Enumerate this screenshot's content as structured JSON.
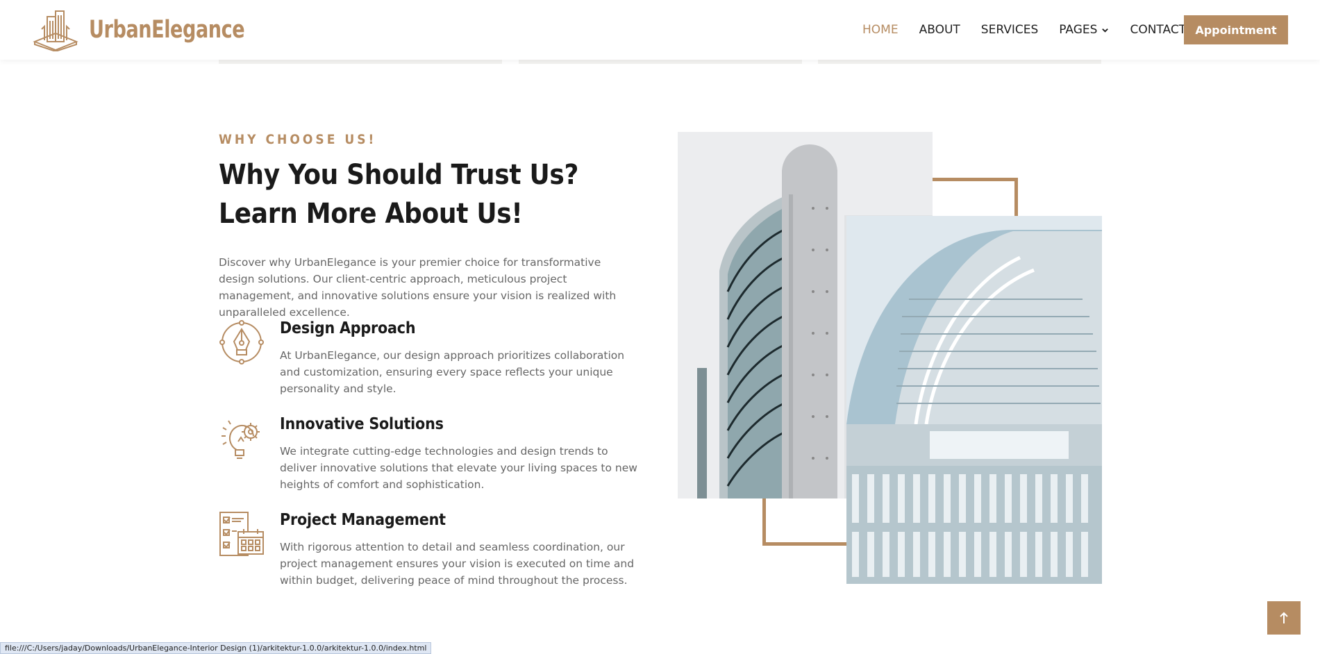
{
  "header": {
    "brand": "UrbanElegance",
    "nav": [
      {
        "label": "HOME",
        "active": true
      },
      {
        "label": "ABOUT",
        "active": false
      },
      {
        "label": "SERVICES",
        "active": false
      },
      {
        "label": "PAGES",
        "active": false,
        "dropdown": true
      },
      {
        "label": "CONTACT",
        "active": false
      }
    ],
    "cta": "Appointment"
  },
  "section": {
    "eyebrow": "WHY CHOOSE US!",
    "title": "Why You Should Trust Us? Learn More About Us!",
    "intro": "Discover why UrbanElegance is your premier choice for transformative design solutions. Our client-centric approach, meticulous project management, and innovative solutions ensure your vision is realized with unparalleled excellence.",
    "features": [
      {
        "icon": "pen-nib-icon",
        "title": "Design Approach",
        "text": "At UrbanElegance, our design approach prioritizes collaboration and customization, ensuring every space reflects your unique personality and style."
      },
      {
        "icon": "lightbulb-gear-icon",
        "title": "Innovative Solutions",
        "text": "We integrate cutting-edge technologies and design trends to deliver innovative solutions that elevate your living spaces to new heights of comfort and sophistication."
      },
      {
        "icon": "checklist-calendar-icon",
        "title": "Project Management",
        "text": "With rigorous attention to detail and seamless coordination, our project management ensures your vision is executed on time and within budget, delivering peace of mind throughout the process."
      }
    ]
  },
  "images": [
    {
      "name": "curved-glass-tower-image"
    },
    {
      "name": "arched-building-image"
    }
  ],
  "status_url": "file:///C:/Users/jaday/Downloads/UrbanElegance-Interior Design (1)/arkitektur-1.0.0/arkitektur-1.0.0/index.html",
  "colors": {
    "accent": "#b68c62",
    "heading": "#1a1a1a",
    "body": "#666666"
  }
}
